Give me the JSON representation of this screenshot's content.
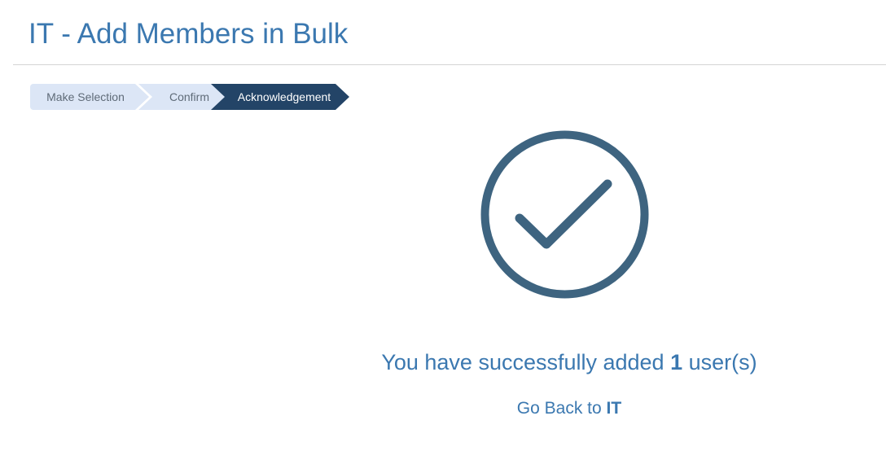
{
  "header": {
    "title": "IT - Add Members in Bulk"
  },
  "stepper": {
    "steps": [
      {
        "label": "Make Selection",
        "state": "completed"
      },
      {
        "label": "Confirm",
        "state": "completed"
      },
      {
        "label": "Acknowledgement",
        "state": "active"
      }
    ]
  },
  "result": {
    "icon": "check-circle-icon",
    "icon_color": "#3e6480",
    "message_prefix": "You have successfully added",
    "count": "1",
    "message_suffix": "user(s)"
  },
  "back_link": {
    "prefix": "Go Back to",
    "target": "IT"
  },
  "colors": {
    "accent": "#3b78b0",
    "step_active": "#234467",
    "step_inactive": "#dce6f6"
  }
}
